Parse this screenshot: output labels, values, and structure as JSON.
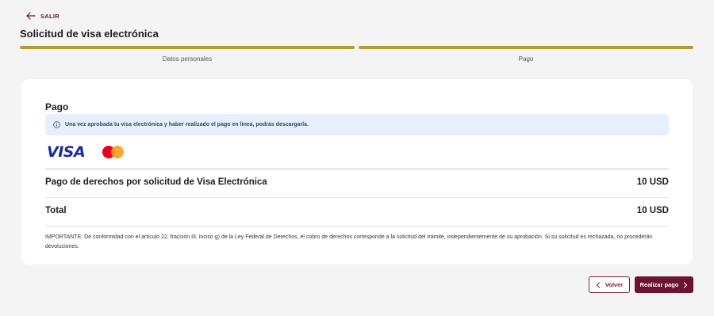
{
  "header": {
    "back_label": "SALIR",
    "title": "Solicitud de visa electrónica"
  },
  "stepper": {
    "steps": [
      {
        "label": "Datos personales"
      },
      {
        "label": "Pago"
      }
    ],
    "accent_color": "#b59a30"
  },
  "payment": {
    "title": "Pago",
    "info_message": "Una vez aprobada tu visa electrónica y haber realizado el pago en línea, podrás descargarla.",
    "card_brands": [
      "VISA",
      "mastercard-logo"
    ],
    "fee_row": {
      "label": "Pago de derechos por solicitud de Visa Electrónica",
      "amount": "10 USD"
    },
    "total_row": {
      "label": "Total",
      "amount": "10 USD"
    },
    "notice": "IMPORTANTE: De conformidad con el artículo 22, fracción III, inciso g) de la Ley Federal de Derechos, el cobro de derechos corresponde a la solicitud del trámite, independientemente de su aprobación. Si su solicitud es rechazada, no procederán devoluciones."
  },
  "actions": {
    "back_label": "Volver",
    "pay_label": "Realizar pago",
    "primary_color": "#6b1430"
  }
}
